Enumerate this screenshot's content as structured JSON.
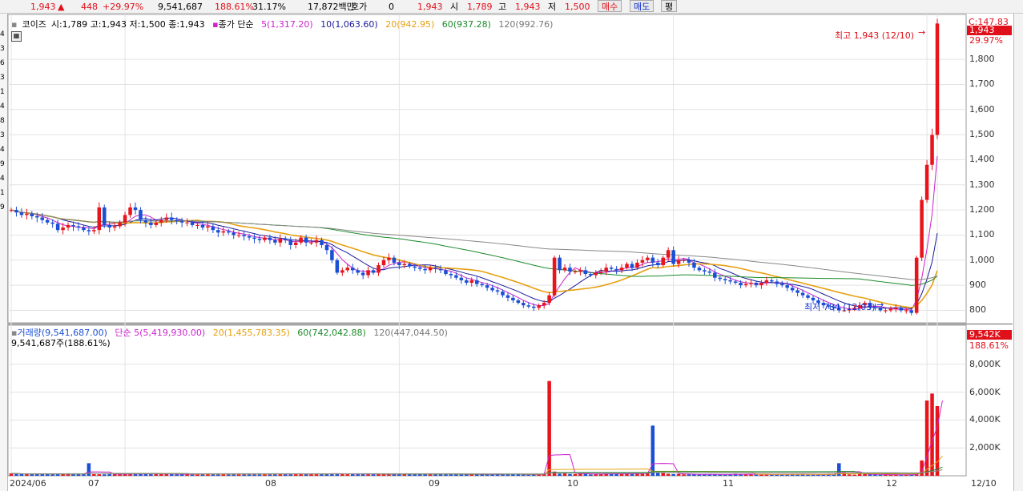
{
  "topbar": {
    "price": "1,943",
    "change": "448",
    "change_pct": "+29.97%",
    "volume": "9,541,687",
    "vol_ratio": "188.61%",
    "turnover": "31.17%",
    "amount": "17,872백만",
    "hoga_label": "호가",
    "hoga_value": "0",
    "hoga_price": "1,943",
    "open_label": "시",
    "open_value": "1,789",
    "high_label": "고",
    "high_value": "1,943",
    "low_label": "저",
    "low_value": "1,500",
    "buy_label": "매수",
    "sell_label": "매도",
    "avg_label": "평"
  },
  "left_strip": [
    "4",
    "3",
    "6",
    "3",
    "1",
    "4",
    "8",
    "3",
    "4",
    "9",
    "4",
    "1",
    "9"
  ],
  "price_panel": {
    "stock_name": "코이즈",
    "ohlc_text": "시:1,789 고:1,943 저:1,500 종:1,943",
    "ma_title": "종가 단순",
    "ma_labels": [
      "5(1,317.20)",
      "10(1,063.60)",
      "20(942.95)",
      "60(937.28)",
      "120(992.76)"
    ],
    "right_top_label": "C:147.83",
    "last_price_badge": "1,943",
    "last_pct": "29.97%",
    "high_annotation": "최고 1,943 (12/10)",
    "low_annotation": "최저 784 (12/03)",
    "colors": {
      "up": "#e8141c",
      "down": "#1a4fd6",
      "ma5": "#cc22cc",
      "ma10": "#1a1a9a",
      "ma20": "#e6a010",
      "ma60": "#1a8a2a",
      "ma120": "#888888"
    }
  },
  "volume_panel": {
    "title": "거래량(9,541,687.00)",
    "ma_title": "단순",
    "ma_labels": [
      "5(5,419,930.00)",
      "20(1,455,783.35)",
      "60(742,042.88)",
      "120(447,044.50)"
    ],
    "sub_label": "9,541,687주(188.61%)",
    "badge": "9,542K",
    "badge_pct": "188.61%"
  },
  "chart_data": {
    "type": "candlestick",
    "x_labels": [
      "2024/06",
      "07",
      "08",
      "09",
      "10",
      "11",
      "12",
      "12/10"
    ],
    "price_axis": {
      "ticks": [
        800,
        900,
        1000,
        1100,
        1200,
        1300,
        1400,
        1500,
        1600,
        1700,
        1800
      ],
      "tick_labels": [
        "800",
        "900",
        "1,000",
        "1,100",
        "1,200",
        "1,300",
        "1,400",
        "1,500",
        "1,600",
        "1,700",
        "1,800"
      ],
      "ylim": [
        760,
        1960
      ]
    },
    "volume_axis": {
      "ticks": [
        2000,
        4000,
        6000,
        8000
      ],
      "tick_labels": [
        "2,000K",
        "4,000K",
        "6,000K",
        "8,000K"
      ],
      "ylim": [
        0,
        10000
      ],
      "unit": "K"
    },
    "close": [
      1200,
      1190,
      1180,
      1185,
      1175,
      1170,
      1160,
      1150,
      1145,
      1120,
      1130,
      1140,
      1135,
      1130,
      1120,
      1115,
      1120,
      1210,
      1140,
      1130,
      1135,
      1150,
      1180,
      1210,
      1200,
      1160,
      1150,
      1140,
      1150,
      1160,
      1170,
      1160,
      1155,
      1150,
      1150,
      1140,
      1140,
      1130,
      1135,
      1120,
      1110,
      1115,
      1110,
      1100,
      1100,
      1095,
      1090,
      1085,
      1080,
      1090,
      1080,
      1070,
      1085,
      1080,
      1060,
      1070,
      1090,
      1070,
      1070,
      1080,
      1060,
      1040,
      1000,
      950,
      960,
      970,
      960,
      950,
      940,
      960,
      950,
      980,
      1000,
      1010,
      990,
      980,
      985,
      975,
      970,
      965,
      960,
      970,
      965,
      960,
      945,
      940,
      930,
      920,
      910,
      920,
      905,
      900,
      890,
      880,
      875,
      860,
      850,
      840,
      830,
      820,
      815,
      810,
      820,
      830,
      860,
      1010,
      960,
      970,
      955,
      955,
      960,
      945,
      940,
      950,
      955,
      970,
      965,
      960,
      970,
      985,
      970,
      990,
      1000,
      1010,
      990,
      980,
      1010,
      1040,
      985,
      1000,
      1000,
      990,
      970,
      960,
      955,
      950,
      930,
      925,
      920,
      915,
      910,
      900,
      905,
      910,
      900,
      910,
      920,
      915,
      905,
      900,
      890,
      880,
      870,
      860,
      850,
      840,
      830,
      820,
      815,
      810,
      800,
      800,
      805,
      810,
      820,
      830,
      815,
      810,
      800,
      800,
      805,
      810,
      800,
      800,
      790,
      1010,
      1240,
      1380,
      1499,
      1943
    ],
    "volume_k": [
      170,
      140,
      120,
      130,
      110,
      150,
      160,
      120,
      110,
      130,
      120,
      140,
      110,
      130,
      130,
      900,
      120,
      110,
      100,
      120,
      130,
      110,
      100,
      150,
      140,
      150,
      130,
      110,
      150,
      140,
      120,
      110,
      100,
      120,
      110,
      100,
      120,
      150,
      130,
      130,
      140,
      110,
      100,
      120,
      130,
      140,
      110,
      130,
      150,
      120,
      140,
      150,
      130,
      120,
      110,
      140,
      150,
      130,
      120,
      160,
      150,
      140,
      170,
      150,
      130,
      110,
      120,
      140,
      130,
      110,
      100,
      120,
      110,
      100,
      150,
      140,
      120,
      110,
      110,
      130,
      120,
      110,
      150,
      130,
      100,
      100,
      120,
      110,
      90,
      120,
      110,
      90,
      80,
      90,
      150,
      110,
      130,
      100,
      90,
      90,
      70,
      100,
      110,
      160,
      6800,
      300,
      150,
      200,
      130,
      120,
      160,
      140,
      90,
      110,
      120,
      160,
      150,
      130,
      140,
      150,
      120,
      180,
      190,
      180,
      3600,
      250,
      200,
      140,
      120,
      130,
      100,
      110,
      90,
      90,
      100,
      110,
      100,
      80,
      70,
      110,
      140,
      120,
      110,
      90,
      80,
      100,
      120,
      90,
      90,
      100,
      110,
      130,
      120,
      100,
      80,
      70,
      60,
      110,
      130,
      120,
      900,
      250,
      100,
      80,
      130,
      120,
      100,
      90,
      70,
      60,
      90,
      70,
      60,
      90,
      70,
      110,
      1100,
      5400,
      5900,
      5000,
      9542
    ]
  }
}
